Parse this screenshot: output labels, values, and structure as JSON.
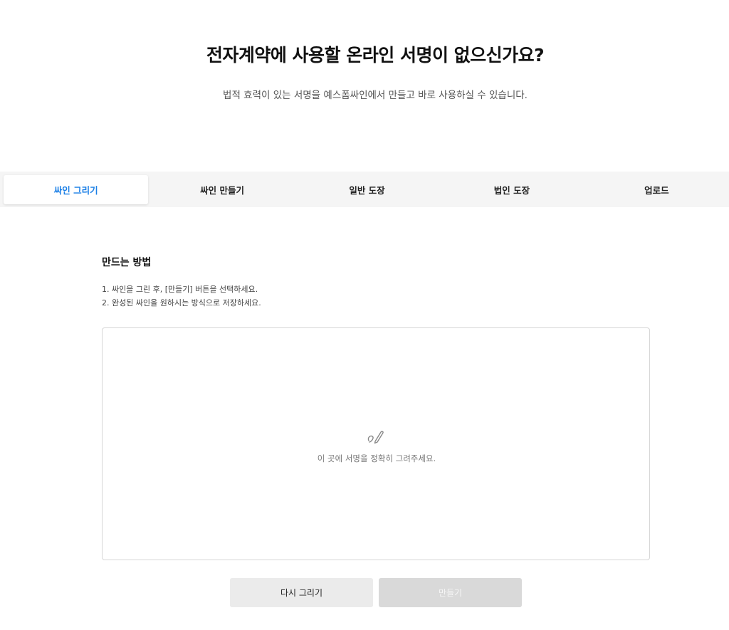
{
  "header": {
    "title": "전자계약에 사용할 온라인 서명이 없으신가요?",
    "subtitle": "법적 효력이 있는 서명을 예스폼싸인에서 만들고 바로 사용하실 수 있습니다."
  },
  "tabs": [
    {
      "label": "싸인 그리기",
      "active": true
    },
    {
      "label": "싸인 만들기",
      "active": false
    },
    {
      "label": "일반 도장",
      "active": false
    },
    {
      "label": "법인 도장",
      "active": false
    },
    {
      "label": "업로드",
      "active": false
    }
  ],
  "howto": {
    "title": "만드는 방법",
    "steps": [
      "1. 싸인을 그린 후, [만들기] 버튼을 선택하세요.",
      "2. 완성된 싸인을 원하시는 방식으로 저장하세요."
    ]
  },
  "canvas": {
    "icon": "signature-pen-icon",
    "hint": "이 곳에 서명을 정확히 그려주세요."
  },
  "buttons": {
    "redraw_label": "다시 그리기",
    "make_label": "만들기"
  },
  "colors": {
    "accent": "#1b7fe6",
    "tab_bar": "#f5f5f5",
    "disabled_button": "#d9d9d9"
  }
}
